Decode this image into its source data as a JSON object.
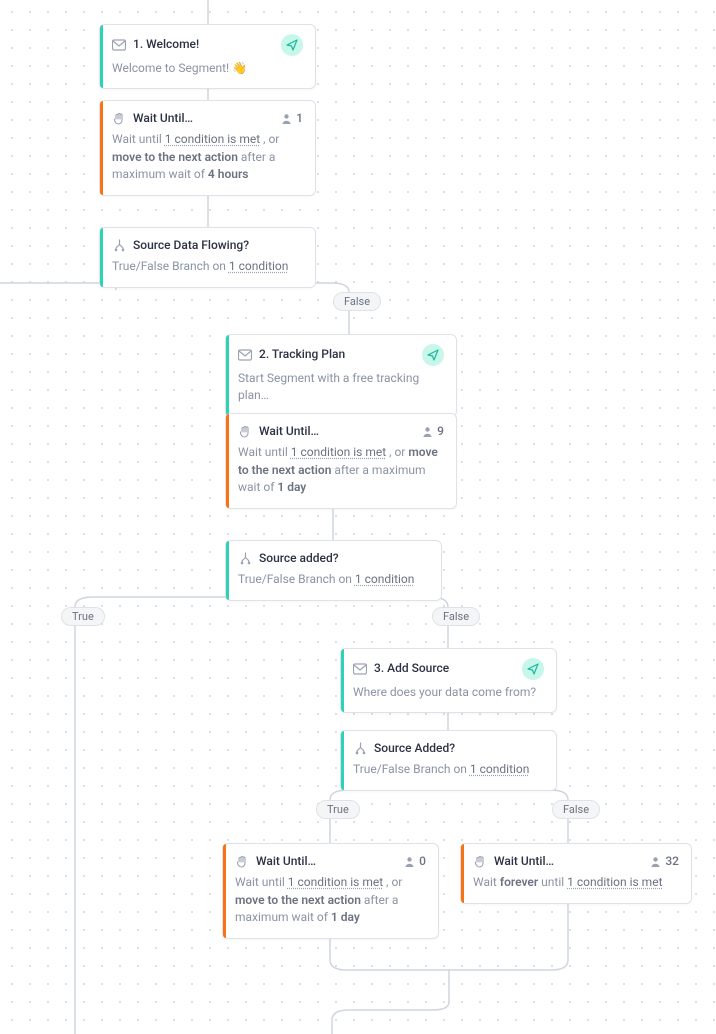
{
  "colors": {
    "teal": "#2ed3b7",
    "orange": "#f97316",
    "pillBg": "#f4f5f7",
    "pillBorder": "#dfe2e8"
  },
  "labels": {
    "true": "True",
    "false": "False"
  },
  "nodes": {
    "welcome": {
      "iconName": "email-icon",
      "sendBadge": true,
      "title": "1. Welcome!",
      "desc": "Welcome to Segment! 👋"
    },
    "wait1": {
      "iconName": "hand-icon",
      "title": "Wait Until…",
      "count": "1",
      "desc_pre": "Wait until ",
      "desc_cond": "1 condition is met",
      "desc_mid": " , or ",
      "desc_move": "move to the next action",
      "desc_aft": " after a maximum wait of ",
      "desc_dur": "4 hours"
    },
    "branchSourceFlowing": {
      "iconName": "branch-icon",
      "title": "Source Data Flowing?",
      "desc_pre": "True/False Branch on ",
      "desc_cond": "1 condition"
    },
    "trackingPlan": {
      "iconName": "email-icon",
      "sendBadge": true,
      "title": "2. Tracking Plan",
      "desc": "Start Segment with a free tracking plan…"
    },
    "wait2": {
      "iconName": "hand-icon",
      "title": "Wait Until…",
      "count": "9",
      "desc_pre": "Wait until ",
      "desc_cond": "1 condition is met",
      "desc_mid": " , or ",
      "desc_move": "move to the next action",
      "desc_aft": " after a maximum wait of ",
      "desc_dur": "1 day"
    },
    "branchSourceAdded1": {
      "iconName": "branch-icon",
      "title": "Source added?",
      "desc_pre": "True/False Branch on ",
      "desc_cond": "1 condition"
    },
    "addSource": {
      "iconName": "email-icon",
      "sendBadge": true,
      "title": "3. Add Source",
      "desc": "Where does your data come from?"
    },
    "branchSourceAdded2": {
      "iconName": "branch-icon",
      "title": "Source Added?",
      "desc_pre": "True/False Branch on ",
      "desc_cond": "1 condition"
    },
    "wait3": {
      "iconName": "hand-icon",
      "title": "Wait Until…",
      "count": "0",
      "desc_pre": "Wait until ",
      "desc_cond": "1 condition is met",
      "desc_mid": " , or ",
      "desc_move": "move to the next action",
      "desc_aft": " after a maximum wait of ",
      "desc_dur": "1 day"
    },
    "wait4": {
      "iconName": "hand-icon",
      "title": "Wait Until…",
      "count": "32",
      "desc_pre": "Wait ",
      "desc_for": "forever",
      "desc_mid2": " until ",
      "desc_cond": "1 condition is met"
    }
  }
}
